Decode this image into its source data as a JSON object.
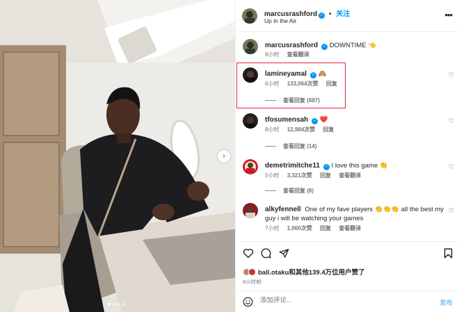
{
  "post": {
    "username": "marcusrashford",
    "follow_label": "关注",
    "separator": "•",
    "location": "Up in the Air"
  },
  "caption": {
    "username": "marcusrashford",
    "text": "DOWNTIME 👈",
    "time": "8小时",
    "translate": "查看翻译"
  },
  "comments": [
    {
      "username": "lamineyamal",
      "text": "🙈",
      "time": "6小时",
      "likes": "133,064次赞",
      "reply": "回复",
      "view_replies": "查看回复 (887)"
    },
    {
      "username": "tfosumensah",
      "text": "❤️",
      "time": "8小时",
      "likes": "12,984次赞",
      "reply": "回复",
      "view_replies": "查看回复 (14)"
    },
    {
      "username": "demetrimitche11",
      "text": "I love this game 👏",
      "time": "5小时",
      "likes": "3,321次赞",
      "reply": "回复",
      "translate": "查看翻译",
      "view_replies": "查看回复 (8)"
    },
    {
      "username": "alkyfennell",
      "text": "One of my fave players 👏👏👏 all the best my guy i will be watching your games",
      "time": "7小时",
      "likes": "1,060次赞",
      "reply": "回复",
      "translate": "查看翻译"
    }
  ],
  "likes_summary": {
    "text": "ball.otaku和其他139.4万位用户赞了"
  },
  "post_time": "8小时前",
  "add_comment": {
    "placeholder": "添加评论...",
    "post_label": "发布"
  },
  "colors": {
    "accent": "#0095f6",
    "highlight_box": "#e3263b",
    "secondary_text": "#737373"
  },
  "icons": [
    "verified-icon",
    "more-options-icon",
    "heart-icon",
    "comment-icon",
    "share-icon",
    "bookmark-icon",
    "emoji-icon",
    "next-arrow-icon"
  ]
}
